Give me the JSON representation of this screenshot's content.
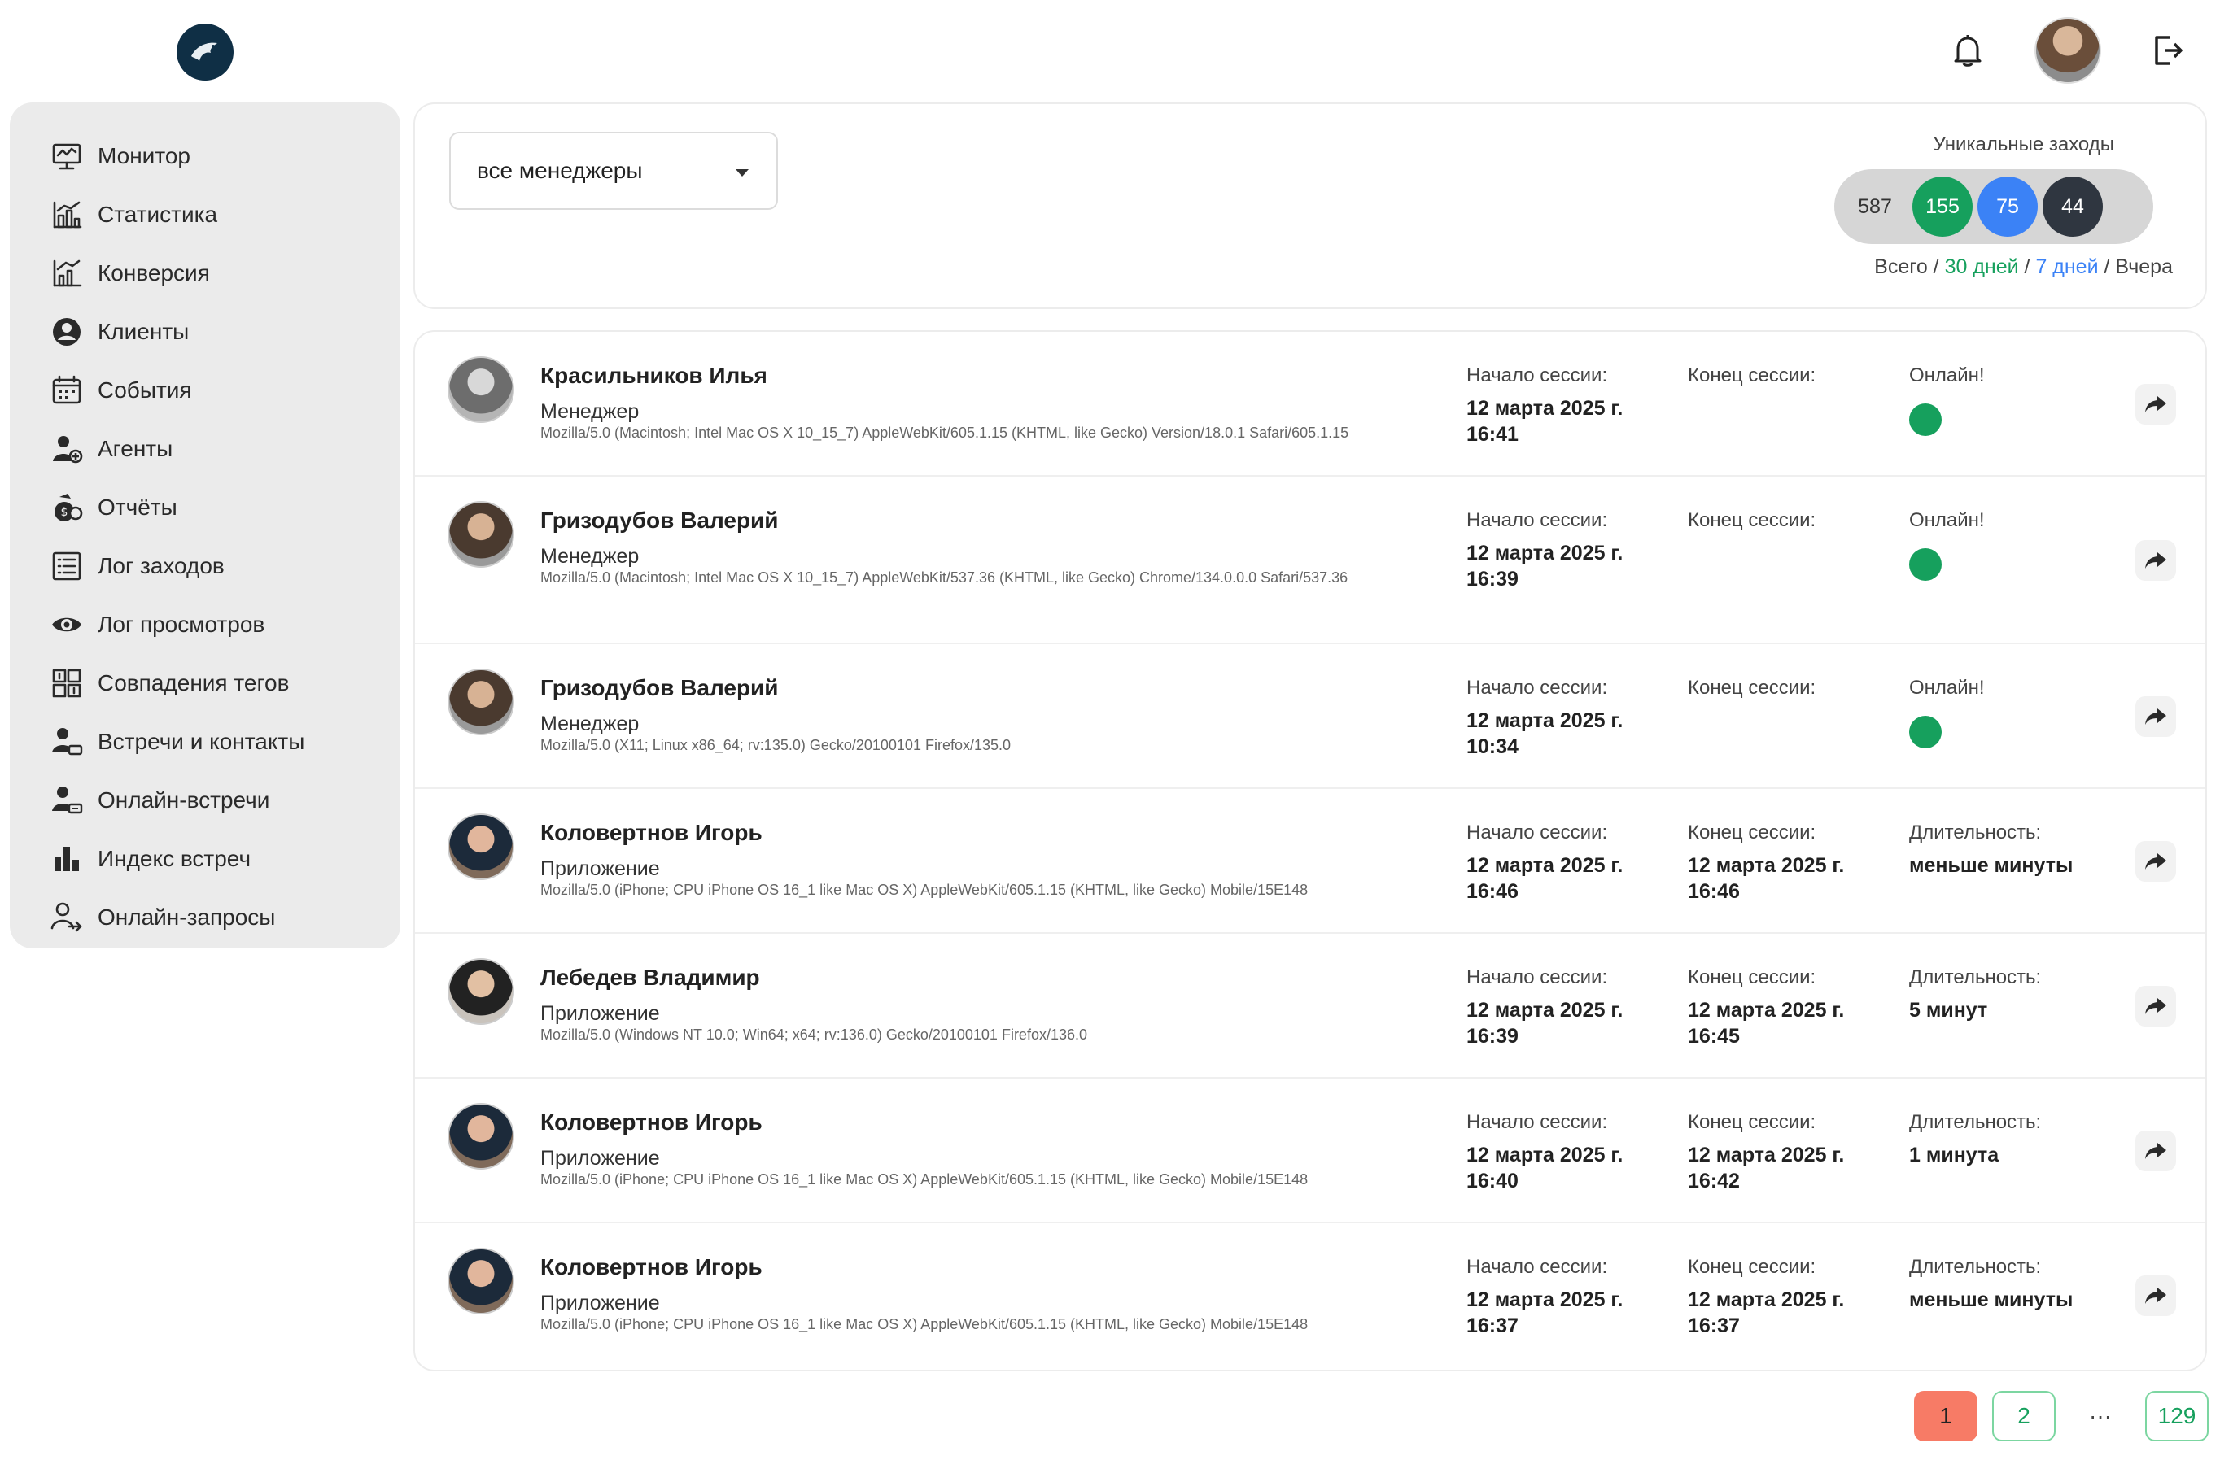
{
  "header": {
    "logo_icon": "eagle-logo-icon",
    "bell_icon": "bell-icon",
    "logout_icon": "logout-icon"
  },
  "sidebar": {
    "items": [
      {
        "label": "Монитор",
        "icon": "monitor-icon"
      },
      {
        "label": "Статистика",
        "icon": "chart-icon"
      },
      {
        "label": "Конверсия",
        "icon": "conversion-icon"
      },
      {
        "label": "Клиенты",
        "icon": "user-circle-icon"
      },
      {
        "label": "События",
        "icon": "calendar-icon"
      },
      {
        "label": "Агенты",
        "icon": "agent-icon"
      },
      {
        "label": "Отчёты",
        "icon": "report-icon"
      },
      {
        "label": "Лог заходов",
        "icon": "list-icon"
      },
      {
        "label": "Лог просмотров",
        "icon": "eye-icon"
      },
      {
        "label": "Совпадения тегов",
        "icon": "tags-match-icon"
      },
      {
        "label": "Встречи и контакты",
        "icon": "meeting-icon"
      },
      {
        "label": "Онлайн-встречи",
        "icon": "online-meeting-icon"
      },
      {
        "label": "Индекс встреч",
        "icon": "bar-chart-icon"
      },
      {
        "label": "Онлайн-запросы",
        "icon": "online-request-icon"
      }
    ]
  },
  "filter": {
    "manager_select": "все менеджеры"
  },
  "unique_visits": {
    "title": "Уникальные заходы",
    "total": "587",
    "days30": "155",
    "days7": "75",
    "yesterday": "44",
    "legend_total": "Всего",
    "legend_sep": " / ",
    "legend_30": "30 дней",
    "legend_7": "7 дней",
    "legend_yesterday": "Вчера",
    "colors": {
      "days30": "#16a05d",
      "days7": "#3b82f6",
      "yesterday": "#2f3640"
    }
  },
  "labels": {
    "start": "Начало сессии:",
    "end": "Конец сессии:",
    "online": "Онлайн!",
    "duration": "Длительность:"
  },
  "sessions": [
    {
      "name": "Красильников Илья",
      "role": "Менеджер",
      "ua": "Mozilla/5.0 (Macintosh; Intel Mac OS X 10_15_7) AppleWebKit/605.1.15 (KHTML, like Gecko) Version/18.0.1 Safari/605.1.15",
      "start_date": "12 марта 2025 г.",
      "start_time": "16:41",
      "end_date": "",
      "end_time": "",
      "online": true,
      "duration": ""
    },
    {
      "name": "Гризодубов Валерий",
      "role": "Менеджер",
      "ua": "Mozilla/5.0 (Macintosh; Intel Mac OS X 10_15_7) AppleWebKit/537.36 (KHTML, like Gecko) Chrome/134.0.0.0 Safari/537.36",
      "start_date": "12 марта 2025 г.",
      "start_time": "16:39",
      "end_date": "",
      "end_time": "",
      "online": true,
      "duration": ""
    },
    {
      "name": "Гризодубов Валерий",
      "role": "Менеджер",
      "ua": "Mozilla/5.0 (X11; Linux x86_64; rv:135.0) Gecko/20100101 Firefox/135.0",
      "start_date": "12 марта 2025 г.",
      "start_time": "10:34",
      "end_date": "",
      "end_time": "",
      "online": true,
      "duration": ""
    },
    {
      "name": "Коловертнов Игорь",
      "role": "Приложение",
      "ua": "Mozilla/5.0 (iPhone; CPU iPhone OS 16_1 like Mac OS X) AppleWebKit/605.1.15 (KHTML, like Gecko) Mobile/15E148",
      "start_date": "12 марта 2025 г.",
      "start_time": "16:46",
      "end_date": "12 марта 2025 г.",
      "end_time": "16:46",
      "online": false,
      "duration": "меньше минуты"
    },
    {
      "name": "Лебедев Владимир",
      "role": "Приложение",
      "ua": "Mozilla/5.0 (Windows NT 10.0; Win64; x64; rv:136.0) Gecko/20100101 Firefox/136.0",
      "start_date": "12 марта 2025 г.",
      "start_time": "16:39",
      "end_date": "12 марта 2025 г.",
      "end_time": "16:45",
      "online": false,
      "duration": "5 минут"
    },
    {
      "name": "Коловертнов Игорь",
      "role": "Приложение",
      "ua": "Mozilla/5.0 (iPhone; CPU iPhone OS 16_1 like Mac OS X) AppleWebKit/605.1.15 (KHTML, like Gecko) Mobile/15E148",
      "start_date": "12 марта 2025 г.",
      "start_time": "16:40",
      "end_date": "12 марта 2025 г.",
      "end_time": "16:42",
      "online": false,
      "duration": "1 минута"
    },
    {
      "name": "Коловертнов Игорь",
      "role": "Приложение",
      "ua": "Mozilla/5.0 (iPhone; CPU iPhone OS 16_1 like Mac OS X) AppleWebKit/605.1.15 (KHTML, like Gecko) Mobile/15E148",
      "start_date": "12 марта 2025 г.",
      "start_time": "16:37",
      "end_date": "12 марта 2025 г.",
      "end_time": "16:37",
      "online": false,
      "duration": "меньше минуты"
    }
  ],
  "pagination": {
    "current": "1",
    "next": "2",
    "dots": "···",
    "last": "129"
  }
}
